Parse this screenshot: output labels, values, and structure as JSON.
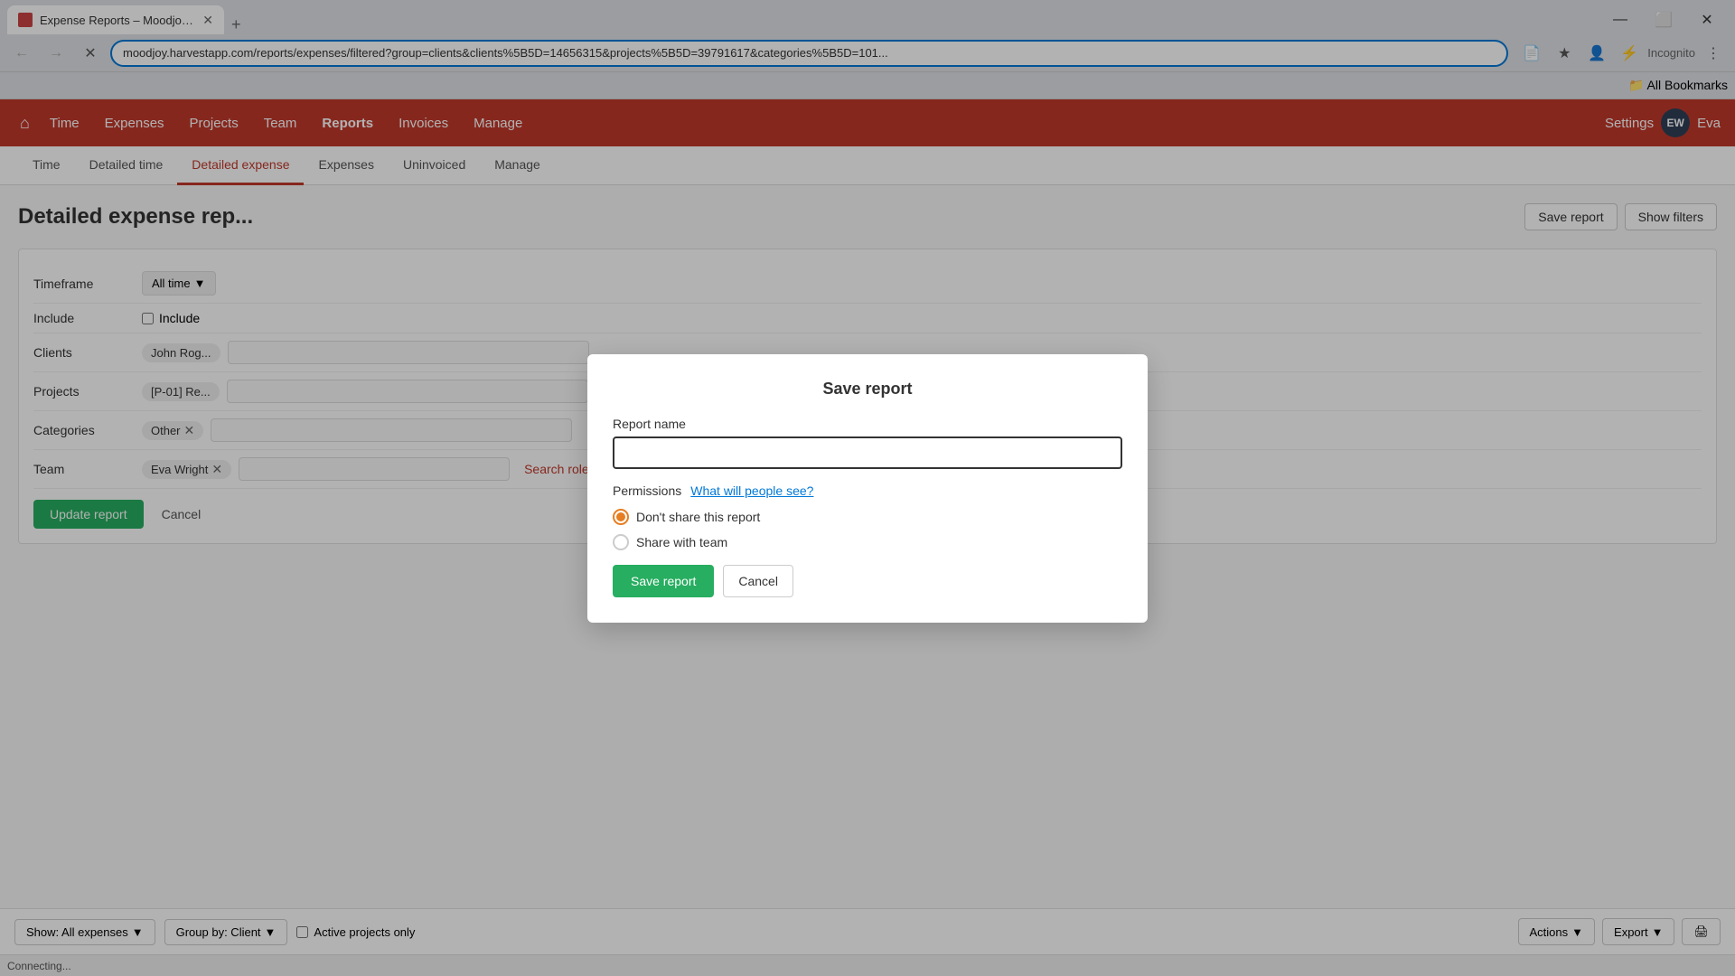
{
  "browser": {
    "tab_title": "Expense Reports – Moodjoy –",
    "address_bar": "moodjoy.harvestapp.com/reports/expenses/filtered?group=clients&clients%5B5D=14656315&projects%5B5D=39791617&categories%5B5D=101...",
    "new_tab_label": "+",
    "loading_text": "Connecting...",
    "bookmarks_label": "All Bookmarks",
    "win_minimize": "—",
    "win_restore": "⬜",
    "win_close": "✕"
  },
  "nav": {
    "home_icon": "⌂",
    "items": [
      "Time",
      "Expenses",
      "Projects",
      "Team",
      "Reports",
      "Invoices",
      "Manage"
    ],
    "active_item": "Reports",
    "settings_label": "Settings",
    "user_initials": "EW",
    "user_name": "Eva"
  },
  "sub_nav": {
    "items": [
      "Time",
      "Detailed time",
      "Detailed expense",
      "Expenses",
      "Uninvoiced",
      "Manage"
    ],
    "active_item": "Detailed expense"
  },
  "page": {
    "title": "Detailed expense rep...",
    "save_report_btn": "Save report",
    "show_filters_btn": "Show filters"
  },
  "filters": {
    "timeframe_label": "Timeframe",
    "timeframe_value": "All time",
    "include_label": "Include",
    "include_checkbox_label": "Include",
    "clients_label": "Clients",
    "clients_tag": "John Rog...",
    "projects_label": "Projects",
    "projects_tag": "[P-01] Re...",
    "categories_label": "Categories",
    "categories_tag": "Other",
    "team_label": "Team",
    "team_tag": "Eva Wright",
    "search_roles_link": "Search roles",
    "update_report_btn": "Update report",
    "cancel_btn": "Cancel"
  },
  "bottom_bar": {
    "show_label": "Show: All expenses",
    "group_label": "Group by: Client",
    "active_projects_label": "Active projects only",
    "actions_btn": "Actions",
    "export_btn": "Export",
    "print_icon": "🖨"
  },
  "modal": {
    "title": "Save report",
    "report_name_label": "Report name",
    "report_name_placeholder": "",
    "permissions_label": "Permissions",
    "what_will_see_link": "What will people see?",
    "radio_options": [
      {
        "id": "no_share",
        "label": "Don't share this report",
        "checked": true
      },
      {
        "id": "share_team",
        "label": "Share with team",
        "checked": false
      }
    ],
    "save_btn": "Save report",
    "cancel_btn": "Cancel"
  },
  "status_bar": {
    "text": "Connecting..."
  }
}
